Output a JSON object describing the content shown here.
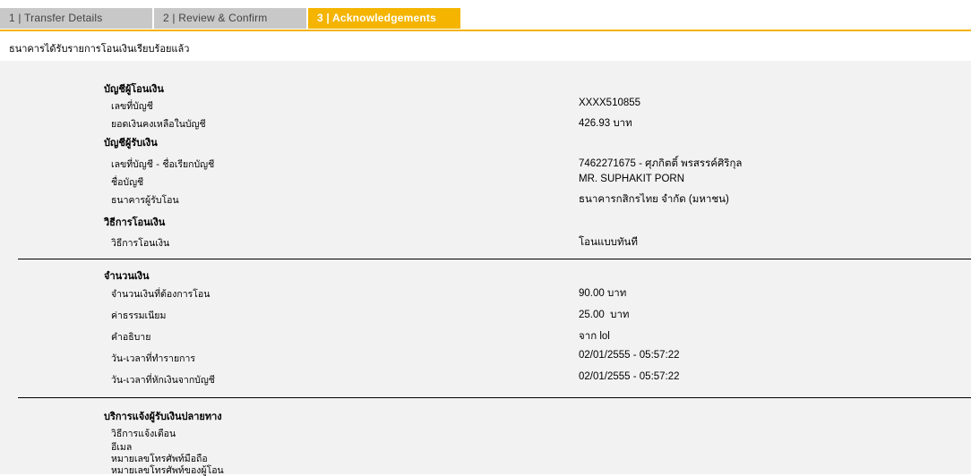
{
  "tabs": [
    {
      "label": "1 | Transfer Details"
    },
    {
      "label": "2 | Review & Confirm"
    },
    {
      "label": "3 | Acknowledgements"
    }
  ],
  "notice": "ธนาคารได้รับรายการโอนเงินเรียบร้อยแล้ว",
  "source_account": {
    "title": "บัญชีผู้โอนเงิน",
    "account_no_label": "เลขที่บัญชี",
    "account_no_value": "XXXX510855",
    "balance_label": "ยอดเงินคงเหลือในบัญชี",
    "balance_value": "426.93 บาท"
  },
  "recipient_account": {
    "title": "บัญชีผู้รับเงิน",
    "account_no_label": "เลขที่บัญชี - ชื่อเรียกบัญชี",
    "account_no_value": "7462271675 - ศุภกิตติ์ พรสรรค์ศิริกุล",
    "account_name_label": "ชื่อบัญชี",
    "account_name_value": "MR. SUPHAKIT PORN",
    "bank_label": "ธนาคารผู้รับโอน",
    "bank_value": "ธนาคารกสิกรไทย จำกัด (มหาชน)"
  },
  "transfer_method": {
    "title": "วิธีการโอนเงิน",
    "method_label": "วิธีการโอนเงิน",
    "method_value": "โอนแบบทันที"
  },
  "amount": {
    "title": "จำนวนเงิน",
    "amount_label": "จำนวนเงินที่ต้องการโอน",
    "amount_value": "90.00 บาท",
    "fee_label": "ค่าธรรมเนียม",
    "fee_value": "25.00  บาท",
    "description_label": "คำอธิบาย",
    "description_value": "จาก lol",
    "transaction_time_label": "วัน-เวลาที่ทำรายการ",
    "transaction_time_value": "02/01/2555 - 05:57:22",
    "debit_time_label": "วัน-เวลาที่หักเงินจากบัญชี",
    "debit_time_value": "02/01/2555 - 05:57:22"
  },
  "notification": {
    "title": "บริการแจ้งผู้รับเงินปลายทาง",
    "method_label": "วิธีการแจ้งเตือน",
    "email_label": "อีเมล",
    "mobile_label": "หมายเลขโทรศัพท์มือถือ",
    "sender_mobile_label": "หมายเลขโทรศัพท์ของผู้โอน"
  }
}
